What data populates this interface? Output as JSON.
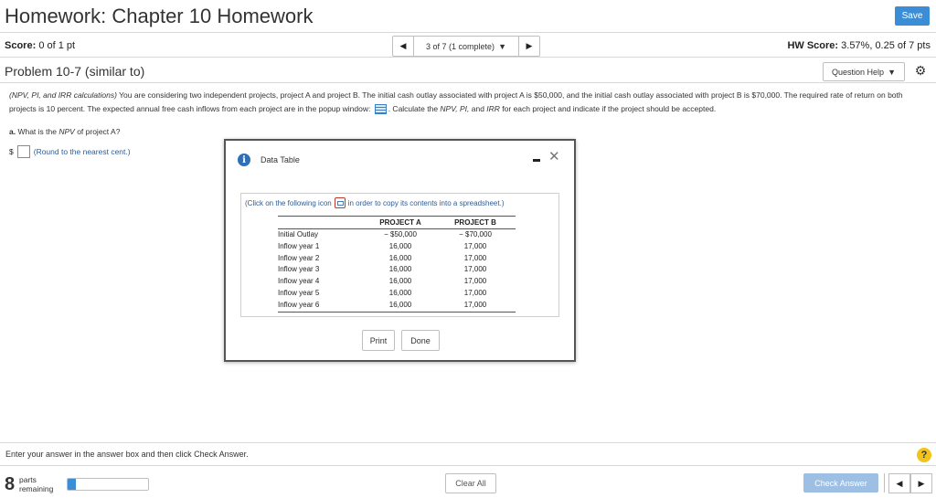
{
  "header": {
    "title": "Homework: Chapter 10 Homework",
    "save_label": "Save"
  },
  "score_bar": {
    "score_label": "Score:",
    "score_value": "0 of 1 pt",
    "hw_score_label": "HW Score:",
    "hw_score_value": "3.57%, 0.25 of 7 pts",
    "question_nav": "3 of 7 (1 complete)"
  },
  "problem": {
    "title": "Problem 10-7 (similar to)",
    "question_help": "Question Help",
    "intro_italic": "(NPV, PI, and IRR calculations)",
    "text_1": " You are considering two independent projects, project A and project B. The initial cash outlay associated with project A is $50,000, and the initial cash outlay associated with project B is $70,000. The required rate of return on both projects is 10 percent. The expected annual free cash inflows from each project are in the popup window:",
    "text_2": ". Calculate the ",
    "text_npv": "NPV, PI,",
    "text_3": " and ",
    "text_irr": "IRR",
    "text_4": " for each project and indicate if the project should be accepted.",
    "part_a_label": "a.",
    "part_a_text_1": " What is the ",
    "part_a_npv": "NPV",
    "part_a_text_2": " of project A?",
    "answer_prefix": "$",
    "answer_value": "",
    "round_hint": "(Round to the nearest cent.)"
  },
  "modal": {
    "title": "Data Table",
    "click_text_1": "(Click on the following icon",
    "click_text_2": "in order to copy its contents into a spreadsheet.)",
    "columns": [
      "",
      "PROJECT A",
      "PROJECT B"
    ],
    "rows": [
      {
        "label": "Initial Outlay",
        "a": "− $50,000",
        "b": "− $70,000"
      },
      {
        "label": "Inflow year 1",
        "a": "16,000",
        "b": "17,000"
      },
      {
        "label": "Inflow year 2",
        "a": "16,000",
        "b": "17,000"
      },
      {
        "label": "Inflow year 3",
        "a": "16,000",
        "b": "17,000"
      },
      {
        "label": "Inflow year 4",
        "a": "16,000",
        "b": "17,000"
      },
      {
        "label": "Inflow year 5",
        "a": "16,000",
        "b": "17,000"
      },
      {
        "label": "Inflow year 6",
        "a": "16,000",
        "b": "17,000"
      }
    ],
    "print_label": "Print",
    "done_label": "Done"
  },
  "footer": {
    "instructions": "Enter your answer in the answer box and then click Check Answer.",
    "parts_count": "8",
    "parts_label_1": "parts",
    "parts_label_2": "remaining",
    "progress_fraction": 0.1,
    "clear_all": "Clear All",
    "check_answer": "Check Answer"
  },
  "colors": {
    "accent": "#3b8ed6",
    "check_answer_disabled": "#9dbfe3",
    "help_yellow": "#f0c419"
  }
}
